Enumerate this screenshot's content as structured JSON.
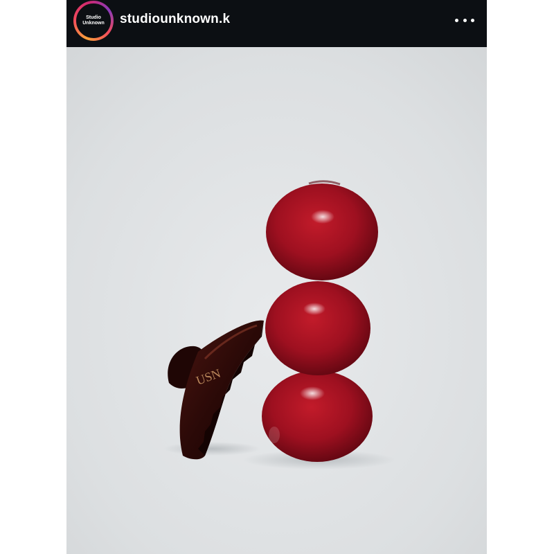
{
  "post": {
    "username": "studiounknown.k",
    "avatar": {
      "line1": "Studio",
      "line2": "Unknown"
    },
    "more_icon": "more-horizontal-icon",
    "claw_logo": "USN"
  },
  "colors": {
    "header_bg": "#0c0f13",
    "photo_bg": "#dfe2e4",
    "apple_red": "#a0111d",
    "claw_brown": "#2b0a07"
  }
}
